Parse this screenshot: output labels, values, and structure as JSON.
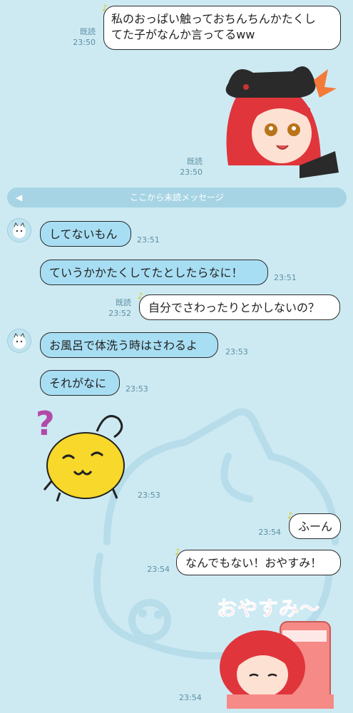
{
  "messages": {
    "m1": {
      "text_line1": "私のおっぱい触っておちんちんかたくし",
      "text_line2": "てた子がなんか言ってるww",
      "read": "既読",
      "time": "23:50"
    },
    "s1": {
      "read": "既読",
      "time": "23:50"
    },
    "unread_divider": "ここから未読メッセージ",
    "m2": {
      "text": "してないもん",
      "time": "23:51"
    },
    "m3": {
      "text": "ていうかかたくしてたとしたらなに！",
      "time": "23:51"
    },
    "m4": {
      "text": "自分でさわったりとかしないの？",
      "read": "既読",
      "time": "23:52"
    },
    "m5": {
      "text": "お風呂で体洗う時はさわるよ",
      "time": "23:53"
    },
    "m6": {
      "text": "それがなに",
      "time": "23:53"
    },
    "s2": {
      "time": "23:53"
    },
    "m7": {
      "text": "ふーん",
      "time": "23:54"
    },
    "m8": {
      "text": "なんでもない！おやすみ！",
      "time": "23:54"
    },
    "s3": {
      "caption": "おやすみ〜",
      "time": "23:54"
    }
  },
  "colors": {
    "background": "#cdeaf3",
    "incoming_bubble": "#a8def3",
    "outgoing_bubble": "#ffffff",
    "meta_text": "#5e8fa3"
  },
  "icons": {
    "avatar": "cat-avatar-icon",
    "read_note": "music-note-icon",
    "divider_tag": "tag-icon"
  }
}
